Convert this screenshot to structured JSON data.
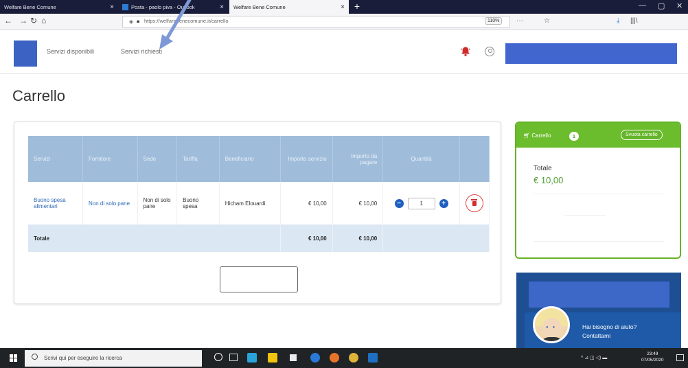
{
  "browser": {
    "tabs": [
      {
        "title": "Welfare Bene Comune",
        "active": false
      },
      {
        "title": "Posta - paolo piva - Outlook",
        "active": false
      },
      {
        "title": "Welfare Bene Comune",
        "active": true
      }
    ],
    "url": "https://welfarebenecomune.it/carrello",
    "zoom": "110%",
    "tab_close": "×",
    "new_tab": "+",
    "window_controls": [
      "—",
      "▢",
      "✕"
    ],
    "nav_icons": {
      "back": "←",
      "forward": "→",
      "reload": "↻",
      "home": "⌂",
      "menu_dots": "···",
      "bookmark": "☆",
      "download": "⤓",
      "library": "|||\\"
    }
  },
  "header": {
    "nav": [
      "Servizi disponibili",
      "Servizi richiesti"
    ]
  },
  "page": {
    "title": "Carrello"
  },
  "cart_table": {
    "columns": [
      "Servizi",
      "Fornitore",
      "Sede",
      "Tariffa",
      "Beneficiario",
      "Importo servizio",
      "Importo da pagare",
      "Quantità"
    ],
    "rows": [
      {
        "servizio": "Buono spesa alimentari",
        "fornitore": "Non di solo pane",
        "sede": "Non di solo pane",
        "tariffa": "Buono spesa",
        "beneficiario": "Hicham Elouardi",
        "importo_servizio": "€ 10,00",
        "importo_da_pagare": "€ 10,00",
        "quantita": "1"
      }
    ],
    "total_row": {
      "label": "Totale",
      "importo_servizio": "€ 10,00",
      "importo_da_pagare": "€ 10,00"
    }
  },
  "summary": {
    "cart_label": "Carrello",
    "cart_count": "1",
    "empty_cart_button": "Svuota carrello",
    "total_label": "Totale",
    "total_value": "€ 10,00"
  },
  "chat": {
    "line1": "Hai bisogno di aiuto?",
    "line2": "Contattami"
  },
  "taskbar": {
    "search_placeholder": "Scrivi qui per eseguire la ricerca",
    "time": "23:49",
    "date": "07/05/2020"
  },
  "colors": {
    "accent_blue": "#3c63c4",
    "table_header": "#9fbdda",
    "total_row": "#dbe7f3",
    "green": "#6cbd2d",
    "dark_blue": "#1d4f92",
    "delete_red": "#e04444"
  }
}
